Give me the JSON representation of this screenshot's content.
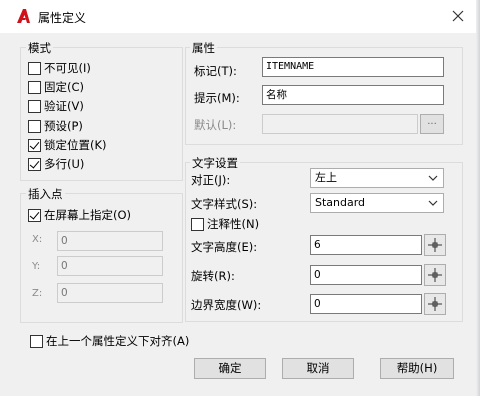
{
  "window": {
    "title": "属性定义",
    "close_icon": "close-icon"
  },
  "mode": {
    "title": "模式",
    "options": [
      {
        "label": "不可见(I)",
        "checked": false
      },
      {
        "label": "固定(C)",
        "checked": false
      },
      {
        "label": "验证(V)",
        "checked": false
      },
      {
        "label": "预设(P)",
        "checked": false
      },
      {
        "label": "锁定位置(K)",
        "checked": true
      },
      {
        "label": "多行(U)",
        "checked": true
      }
    ]
  },
  "attribute": {
    "title": "属性",
    "tag_label": "标记(T):",
    "tag_value": "ITEMNAME",
    "prompt_label": "提示(M):",
    "prompt_value": "名称",
    "default_label": "默认(L):",
    "default_value": "",
    "default_btn": "..."
  },
  "insertion": {
    "title": "插入点",
    "specify_label": "在屏幕上指定(O)",
    "specify_checked": true,
    "x_label": "X:",
    "x_value": "0",
    "y_label": "Y:",
    "y_value": "0",
    "z_label": "Z:",
    "z_value": "0"
  },
  "text": {
    "title": "文字设置",
    "justify_label": "对正(J):",
    "justify_value": "左上",
    "style_label": "文字样式(S):",
    "style_value": "Standard",
    "annotative_label": "注释性(N)",
    "annotative_checked": false,
    "height_label": "文字高度(E):",
    "height_value": "6",
    "rotation_label": "旋转(R):",
    "rotation_value": "0",
    "width_label": "边界宽度(W):",
    "width_value": "0"
  },
  "align_below": {
    "label": "在上一个属性定义下对齐(A)",
    "checked": false
  },
  "buttons": {
    "ok": "确定",
    "cancel": "取消",
    "help": "帮助(H)"
  },
  "colors": {
    "logo_red": "#d0121b",
    "background_dark": "#1f2329"
  }
}
